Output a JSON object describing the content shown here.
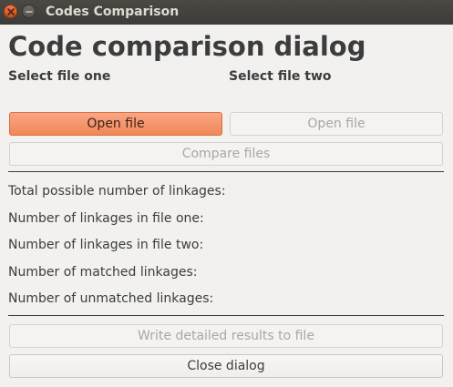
{
  "window": {
    "title": "Codes Comparison"
  },
  "header": {
    "title": "Code comparison dialog"
  },
  "files": {
    "file_one_label": "Select file one",
    "file_two_label": "Select file two",
    "open_file_one": "Open file",
    "open_file_two": "Open file",
    "compare": "Compare files"
  },
  "stats": {
    "total": "Total possible number of linkages:",
    "file_one": "Number of linkages in file one:",
    "file_two": "Number of linkages in file two:",
    "matched": "Number of matched linkages:",
    "unmatched": "Number of unmatched linkages:"
  },
  "actions": {
    "write_results": "Write detailed results to file",
    "close": "Close dialog"
  },
  "colors": {
    "accent": "#f18858",
    "titlebar": "#3c3b37",
    "background": "#f2f1f0"
  },
  "icons": {
    "close": "close-icon",
    "minimize": "minimize-icon"
  }
}
